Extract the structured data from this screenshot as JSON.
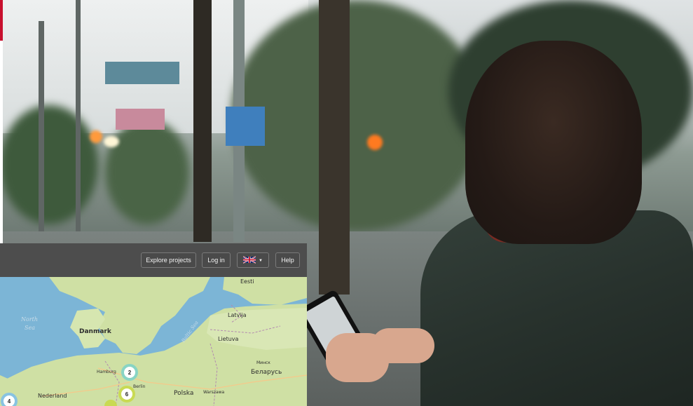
{
  "header": {
    "explore_label": "Explore projects",
    "login_label": "Log in",
    "language": {
      "selected": "English",
      "icon": "uk-flag-icon"
    },
    "help_label": "Help"
  },
  "map": {
    "labels": {
      "eesti": "Eesti",
      "north": "North",
      "sea": "Sea",
      "latvija": "Latvija",
      "danmark": "Danmark",
      "baltic_sea": "Baltic Sea",
      "lietuva": "Lietuva",
      "hamburg": "Hamburg",
      "berlin": "Berlin",
      "minsk": "Минск",
      "belarus": "Беларусь",
      "polska": "Polska",
      "warszawa": "Warszawa",
      "nederland": "Nederland"
    },
    "clusters": [
      {
        "count": "2",
        "color": "#7fd3c8"
      },
      {
        "count": "6",
        "color": "#c8d94a"
      },
      {
        "count": "4",
        "color": "#7fc0e8"
      }
    ]
  },
  "colors": {
    "toolbar": "#4d4d4d",
    "water": "#7cb5d6",
    "land": "#cfe0a4",
    "brand_red": "#c8102e"
  }
}
